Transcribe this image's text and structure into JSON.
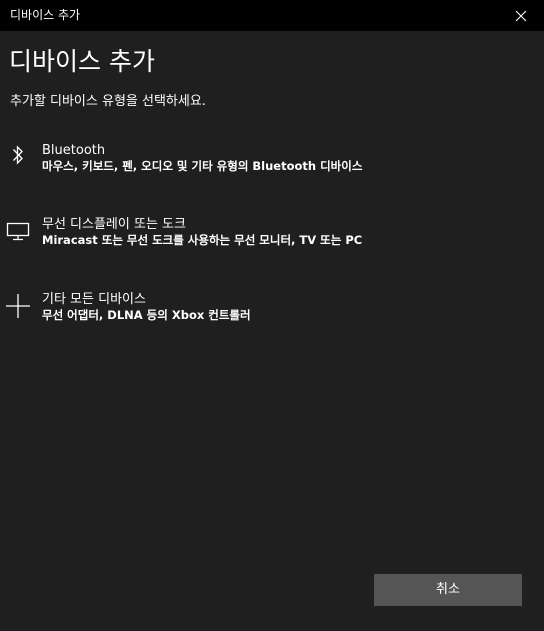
{
  "window": {
    "title": "디바이스 추가"
  },
  "dialog": {
    "heading": "디바이스 추가",
    "subheading": "추가할 디바이스 유형을 선택하세요."
  },
  "options": [
    {
      "icon": "bluetooth-icon",
      "title": "Bluetooth",
      "description": "마우스, 키보드, 펜, 오디오 및 기타 유형의 Bluetooth 디바이스"
    },
    {
      "icon": "monitor-icon",
      "title": "무선 디스플레이 또는 도크",
      "description": "Miracast 또는 무선 도크를 사용하는 무선 모니터, TV 또는 PC"
    },
    {
      "icon": "plus-icon",
      "title": "기타 모든 디바이스",
      "description": "무선 어댑터, DLNA 등의 Xbox 컨트롤러"
    }
  ],
  "buttons": {
    "cancel": "취소"
  },
  "colors": {
    "titlebar": "#000000",
    "background": "#1f1f1f",
    "text": "#ffffff",
    "button": "#555555"
  }
}
